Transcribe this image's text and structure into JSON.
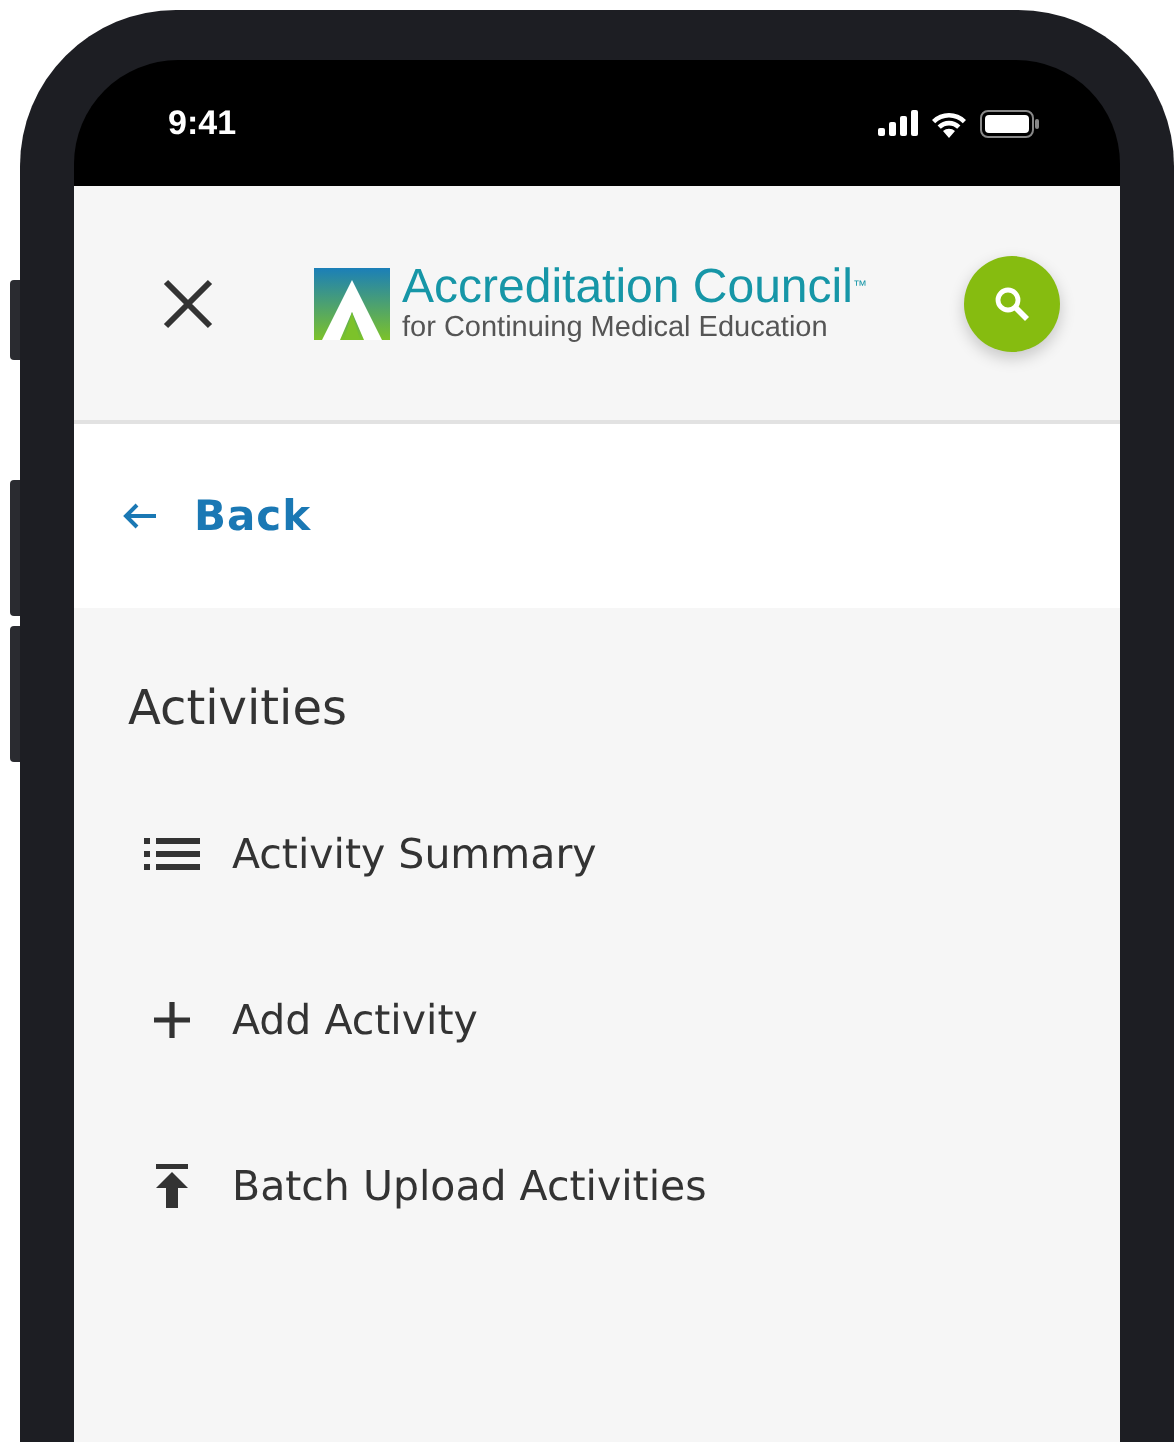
{
  "status_bar": {
    "time": "9:41"
  },
  "header": {
    "logo": {
      "title": "Accreditation Council$^{™}$",
      "subtitle": "for Continuing Medical Education"
    }
  },
  "back": {
    "label": "Back"
  },
  "section": {
    "title": "Activities"
  },
  "menu": [
    {
      "kind": "list",
      "label": "Activity Summary"
    },
    {
      "kind": "plus",
      "label": "Add Activity"
    },
    {
      "kind": "upload",
      "label": "Batch Upload Activities"
    }
  ]
}
